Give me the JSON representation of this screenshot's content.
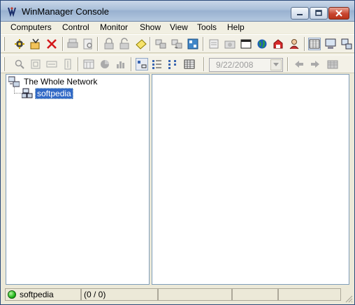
{
  "window": {
    "title": "WinManager Console"
  },
  "menu": [
    "Computers",
    "Control",
    "Monitor",
    "Show",
    "View",
    "Tools",
    "Help"
  ],
  "toolbar": {
    "date_value": "9/22/2008"
  },
  "tree": {
    "root_label": "The Whole Network",
    "child_label": "softpedia"
  },
  "status": {
    "computer": "softpedia",
    "counts": "(0 / 0)"
  },
  "icons": [
    "app-logo-icon",
    "connect-computer-icon",
    "properties-icon",
    "delete-icon",
    "print-icon",
    "print-preview-icon",
    "lock-icon",
    "unlock-icon",
    "note-icon",
    "copy-to-icon",
    "move-to-icon",
    "sync-icon",
    "doc-icon",
    "camera-icon",
    "window-icon",
    "globe-icon",
    "card-icon",
    "users-icon",
    "grid-view-icon",
    "computer-icon",
    "network-icon"
  ],
  "colors": {
    "selection": "#3169c6",
    "close_button": "#c8452f",
    "status_ok": "#22b81a"
  }
}
